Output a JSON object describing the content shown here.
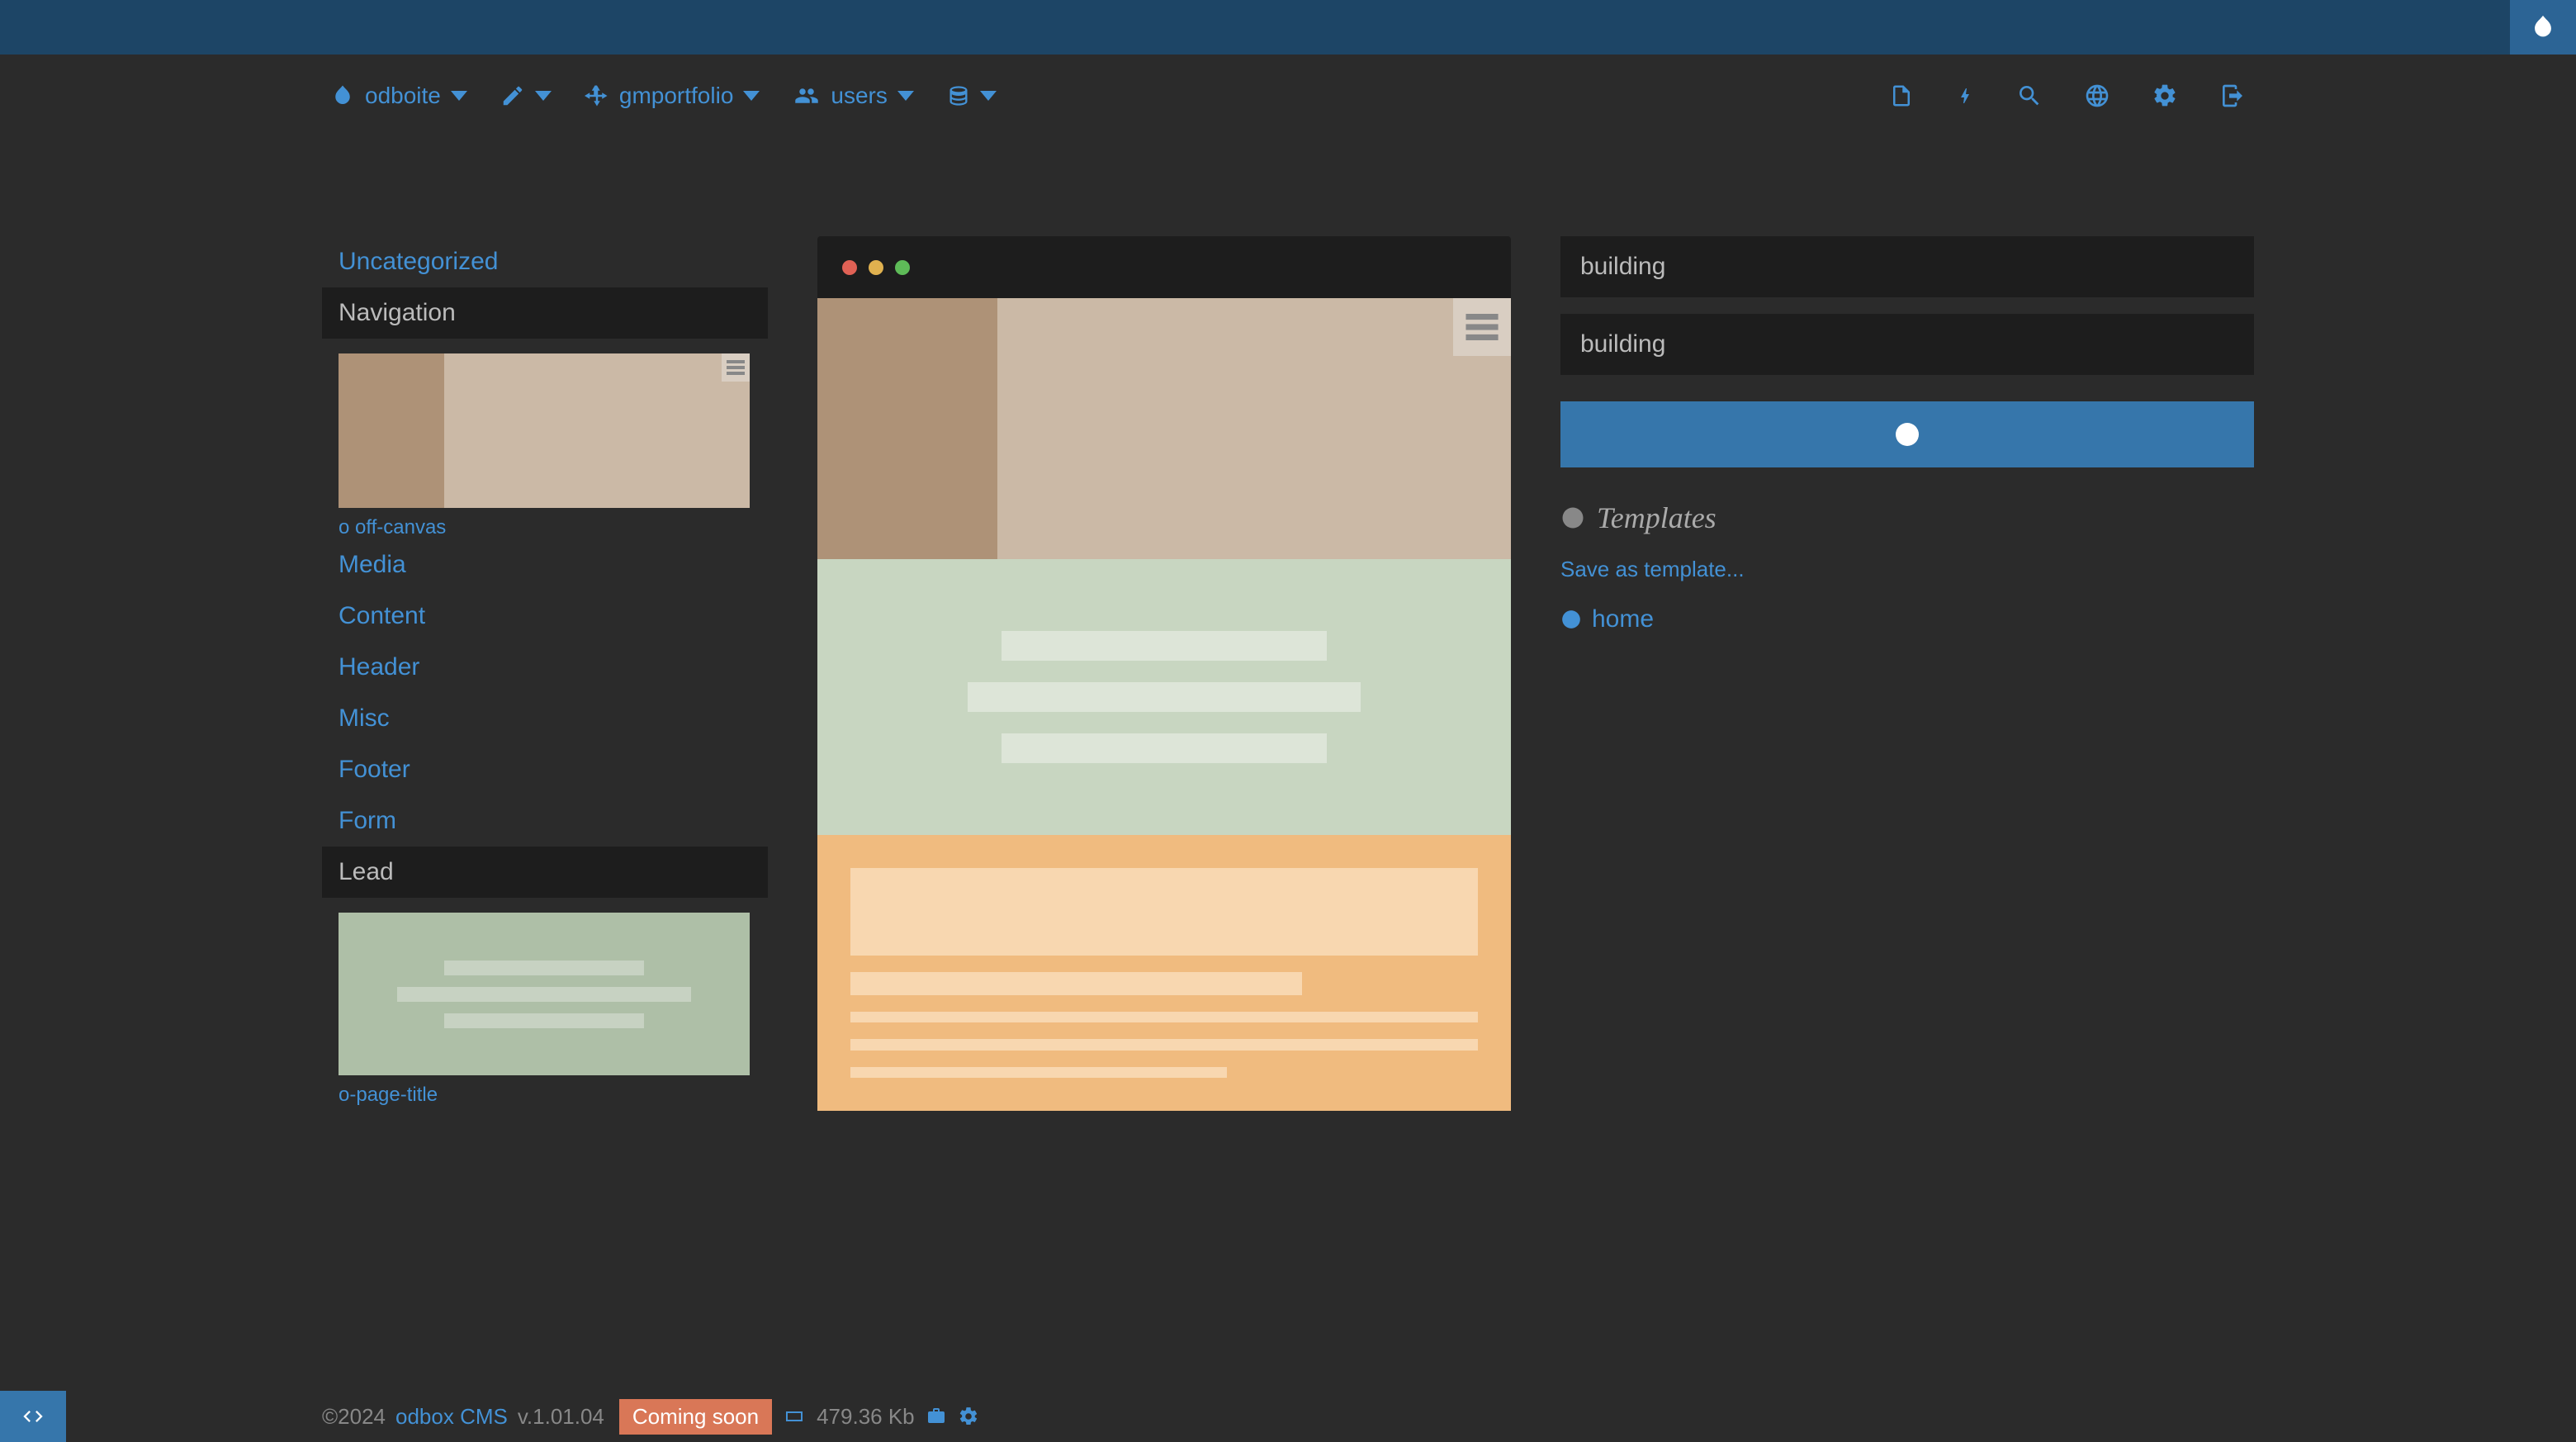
{
  "nav": {
    "brand": "odboite",
    "site": "gmportfolio",
    "users": "users"
  },
  "sidebar": {
    "categories": [
      "Uncategorized",
      "Navigation",
      "Media",
      "Content",
      "Header",
      "Misc",
      "Footer",
      "Form",
      "Lead"
    ],
    "thumb_nav_label": "o off-canvas",
    "thumb_lead_label": "o-page-title"
  },
  "right": {
    "input1": "building",
    "input2": "building",
    "templates_header": "Templates",
    "save_link": "Save as template...",
    "template_item": "home"
  },
  "footer": {
    "copyright": "©2024",
    "link": "odbox CMS",
    "version": "v.1.01.04",
    "badge": "Coming soon",
    "size": "479.36 Kb"
  }
}
